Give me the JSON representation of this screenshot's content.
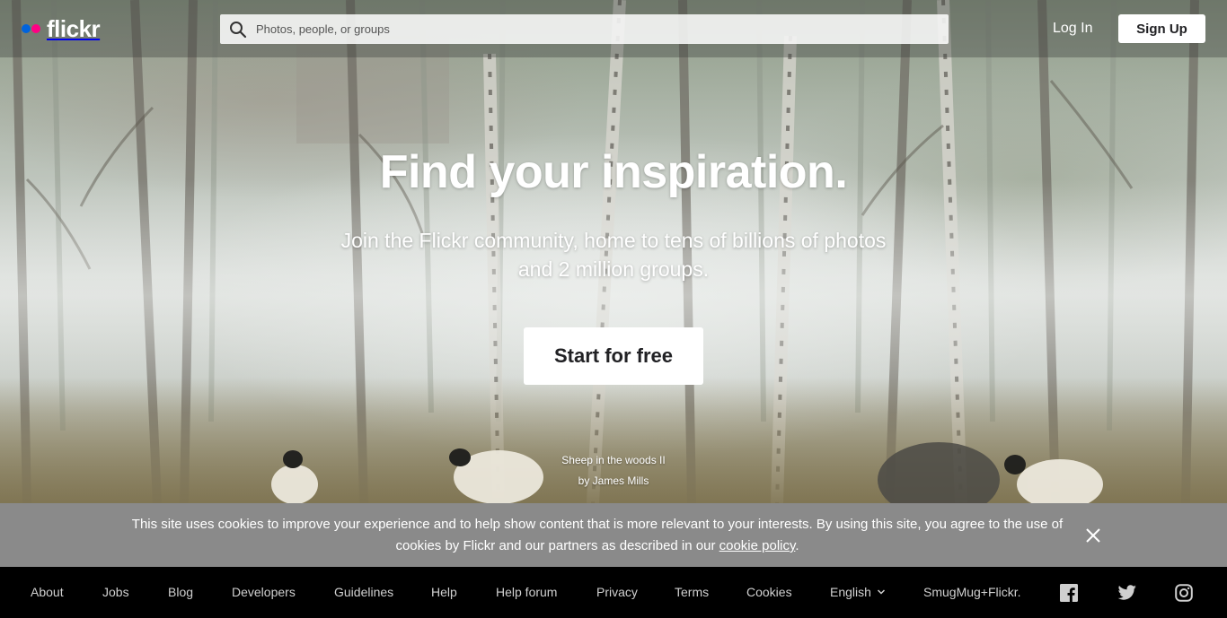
{
  "brand": {
    "name": "flickr",
    "colors": {
      "blue": "#0063dc",
      "pink": "#ff0084"
    }
  },
  "search": {
    "placeholder": "Photos, people, or groups",
    "value": ""
  },
  "nav": {
    "login": "Log In",
    "signup": "Sign Up"
  },
  "hero": {
    "title": "Find your inspiration.",
    "subtitle": "Join the Flickr community, home to tens of billions of photos and 2 million groups.",
    "cta": "Start for free",
    "photo_title": "Sheep in the woods II",
    "photo_credit": "by James Mills"
  },
  "cookie": {
    "text": "This site uses cookies to improve your experience and to help show content that is more relevant to your interests. By using this site, you agree to the use of cookies by Flickr and our partners as described in our",
    "link": "cookie policy",
    "after": "."
  },
  "footer": {
    "links": [
      "About",
      "Jobs",
      "Blog",
      "Developers",
      "Guidelines",
      "Help",
      "Help forum",
      "Privacy",
      "Terms",
      "Cookies"
    ],
    "language": "English",
    "smugmug": "SmugMug+Flickr.",
    "social": [
      "facebook-icon",
      "twitter-icon",
      "instagram-icon"
    ]
  }
}
